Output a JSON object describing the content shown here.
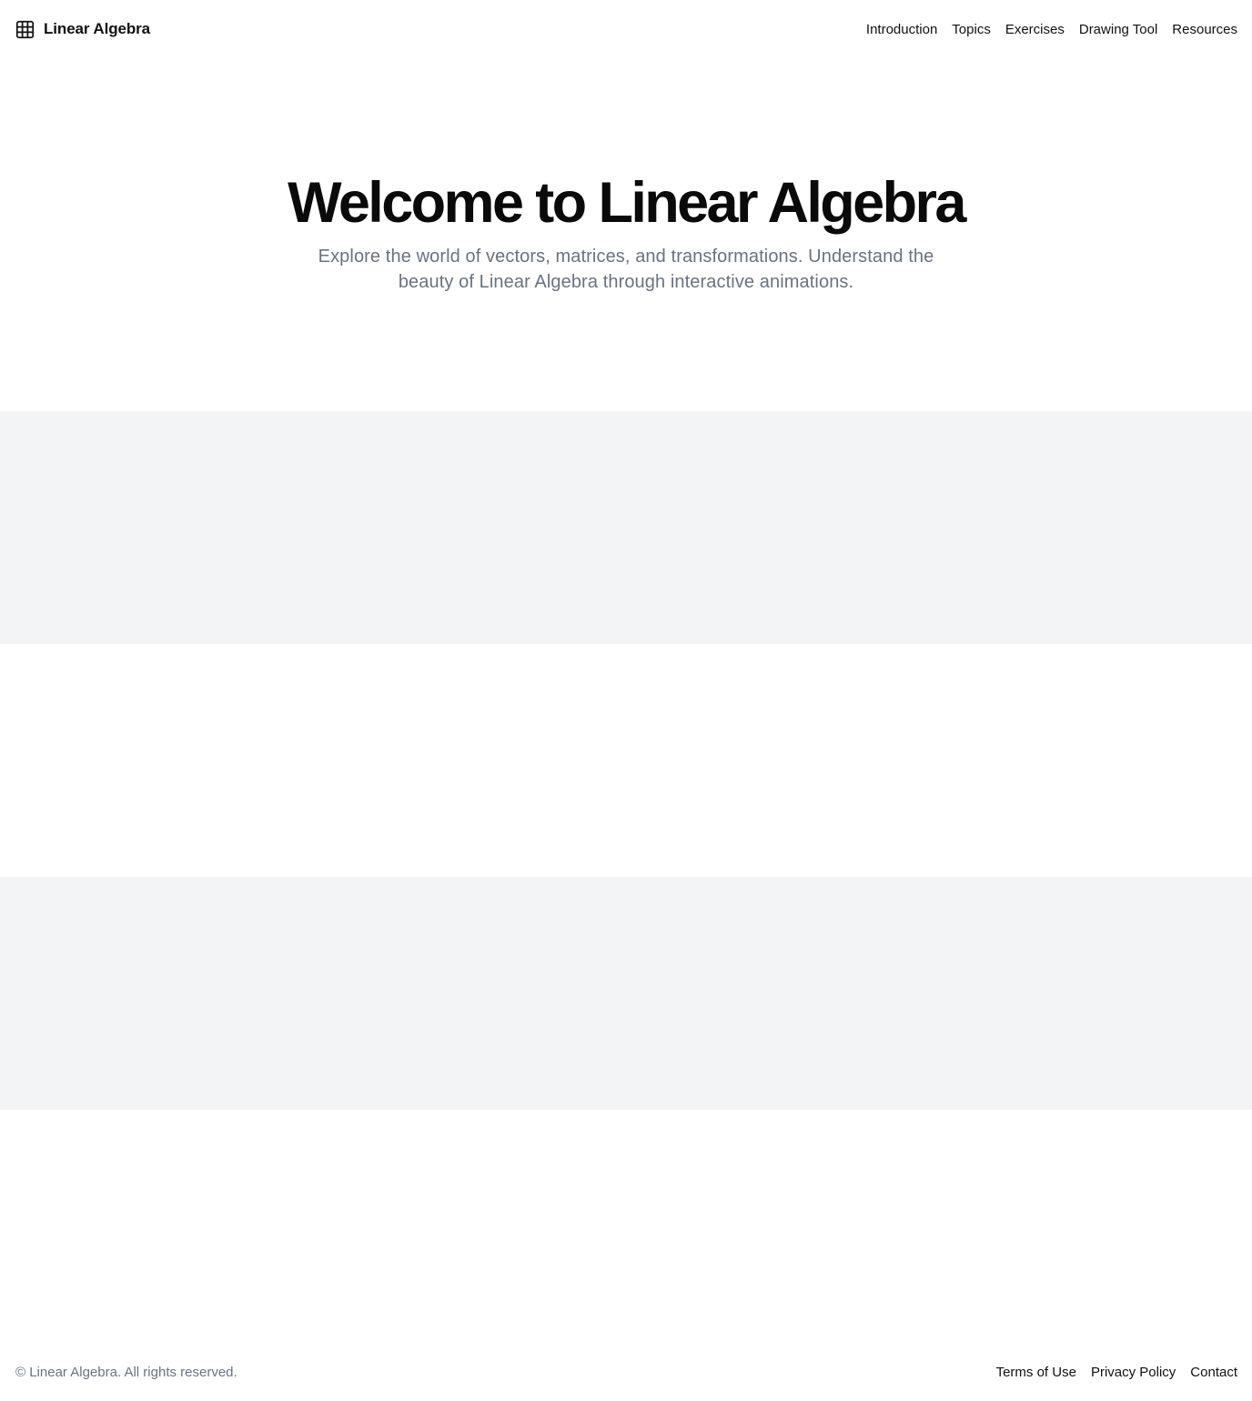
{
  "header": {
    "brand": {
      "icon": "grid-icon",
      "name": "Linear Algebra"
    },
    "nav": [
      {
        "label": "Introduction"
      },
      {
        "label": "Topics"
      },
      {
        "label": "Exercises"
      },
      {
        "label": "Drawing Tool"
      },
      {
        "label": "Resources"
      }
    ]
  },
  "hero": {
    "title": "Welcome to Linear Algebra",
    "subtitle": "Explore the world of vectors, matrices, and transformations. Understand the beauty of Linear Algebra through interactive animations."
  },
  "colors": {
    "text": "#111111",
    "muted": "#6b7280",
    "section_bg": "#f3f4f6",
    "page_bg": "#ffffff"
  },
  "footer": {
    "copyright": "© Linear Algebra. All rights reserved.",
    "links": [
      {
        "label": "Terms of Use"
      },
      {
        "label": "Privacy Policy"
      },
      {
        "label": "Contact"
      }
    ]
  }
}
